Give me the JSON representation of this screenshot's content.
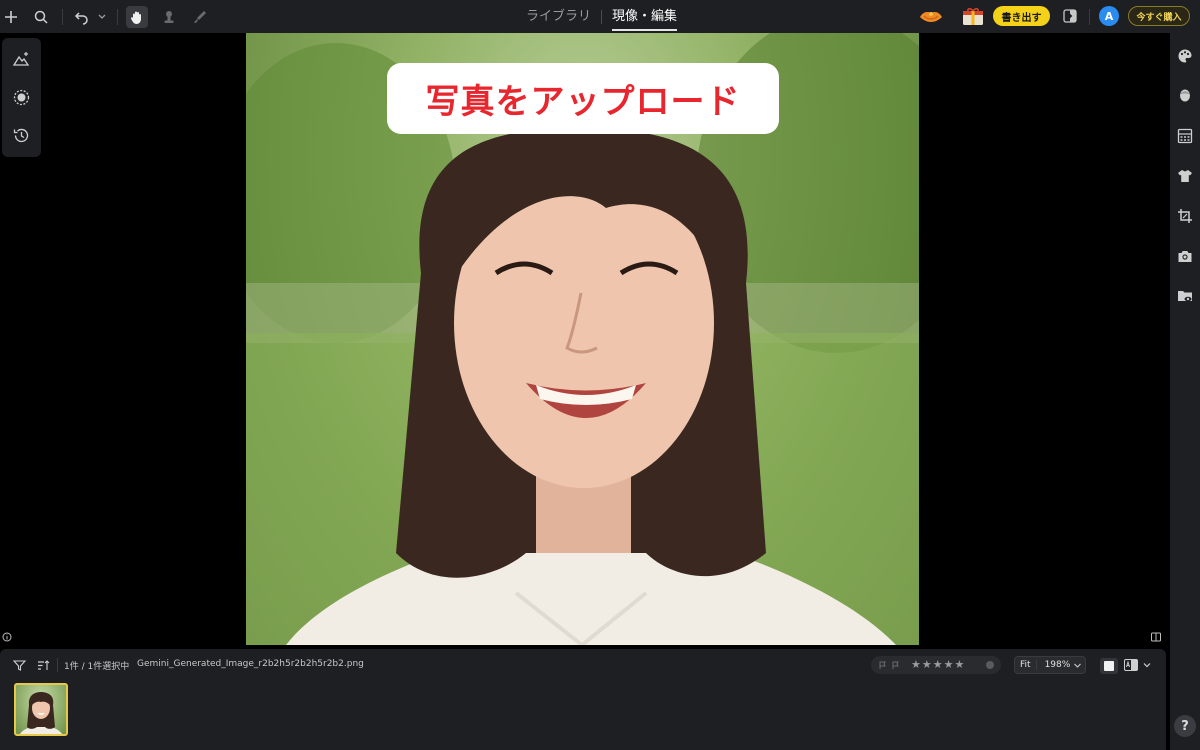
{
  "topbar": {
    "tabs": [
      {
        "label": "ライブラリ",
        "active": false
      },
      {
        "label": "現像・編集",
        "active": true
      }
    ],
    "export_label": "書き出す",
    "avatar_initial": "A",
    "buy_label": "今すぐ購入",
    "icons": [
      "plus-icon",
      "search-icon",
      "undo-icon",
      "chevron-down-icon",
      "hand-icon",
      "stamp-icon",
      "brush-icon",
      "gift-icon",
      "promo-icon",
      "share-icon"
    ]
  },
  "left_tools": [
    "ai-mountain-icon",
    "sparkle-circle-icon",
    "history-icon"
  ],
  "right_rail": [
    "palette-icon",
    "face-icon",
    "grid-pattern-icon",
    "shirt-icon",
    "crop-icon",
    "camera-icon",
    "folder-eye-icon"
  ],
  "canvas": {
    "banner_text": "写真をアップロード"
  },
  "filmstrip": {
    "selection_text": "1件 / 1件選択中",
    "filename": "Gemini_Generated_Image_r2b2h5r2b2h5r2b2.png",
    "stars": "★★★★★",
    "fit_label": "Fit",
    "zoom_value": "198%"
  },
  "help_label": "?",
  "colors": {
    "accent_yellow": "#f5d21a",
    "banner_text": "#e8262e",
    "avatar_blue": "#2a8cf0",
    "panel_bg": "#1e1f22"
  }
}
